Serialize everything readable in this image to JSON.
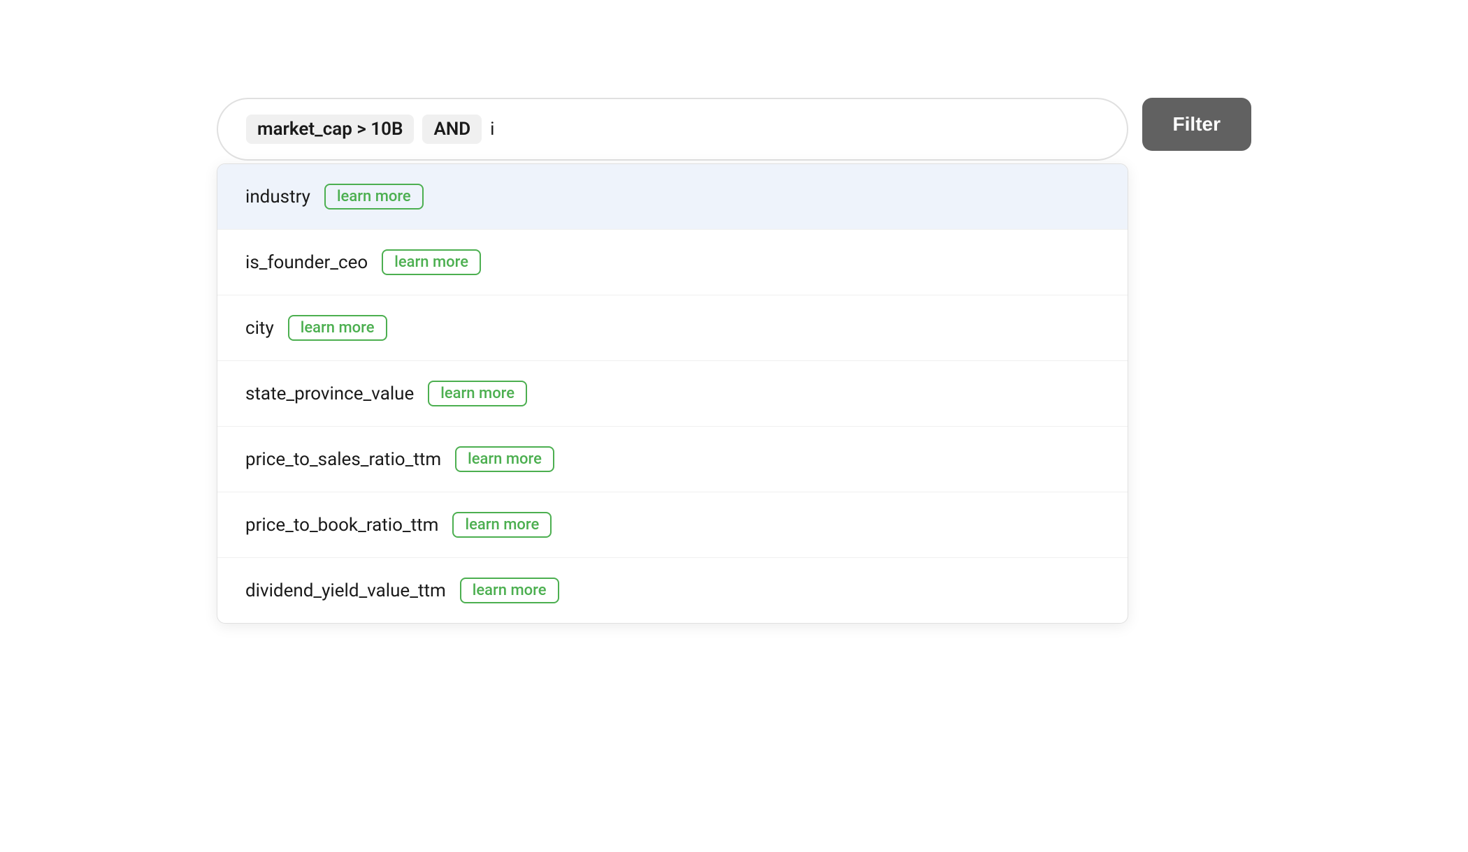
{
  "search": {
    "token": "market_cap > 10B",
    "operator": "AND",
    "cursor": "i"
  },
  "filter_button": {
    "label": "Filter"
  },
  "dropdown": {
    "items": [
      {
        "id": "industry",
        "name": "industry",
        "highlighted": true,
        "learn_more": "learn more"
      },
      {
        "id": "is_founder_ceo",
        "name": "is_founder_ceo",
        "highlighted": false,
        "learn_more": "learn more"
      },
      {
        "id": "city",
        "name": "city",
        "highlighted": false,
        "learn_more": "learn more"
      },
      {
        "id": "state_province_value",
        "name": "state_province_value",
        "highlighted": false,
        "learn_more": "learn more"
      },
      {
        "id": "price_to_sales_ratio_ttm",
        "name": "price_to_sales_ratio_ttm",
        "highlighted": false,
        "learn_more": "learn more"
      },
      {
        "id": "price_to_book_ratio_ttm",
        "name": "price_to_book_ratio_ttm",
        "highlighted": false,
        "learn_more": "learn more"
      },
      {
        "id": "dividend_yield_value_ttm",
        "name": "dividend_yield_value_ttm",
        "highlighted": false,
        "learn_more": "learn more"
      }
    ]
  }
}
